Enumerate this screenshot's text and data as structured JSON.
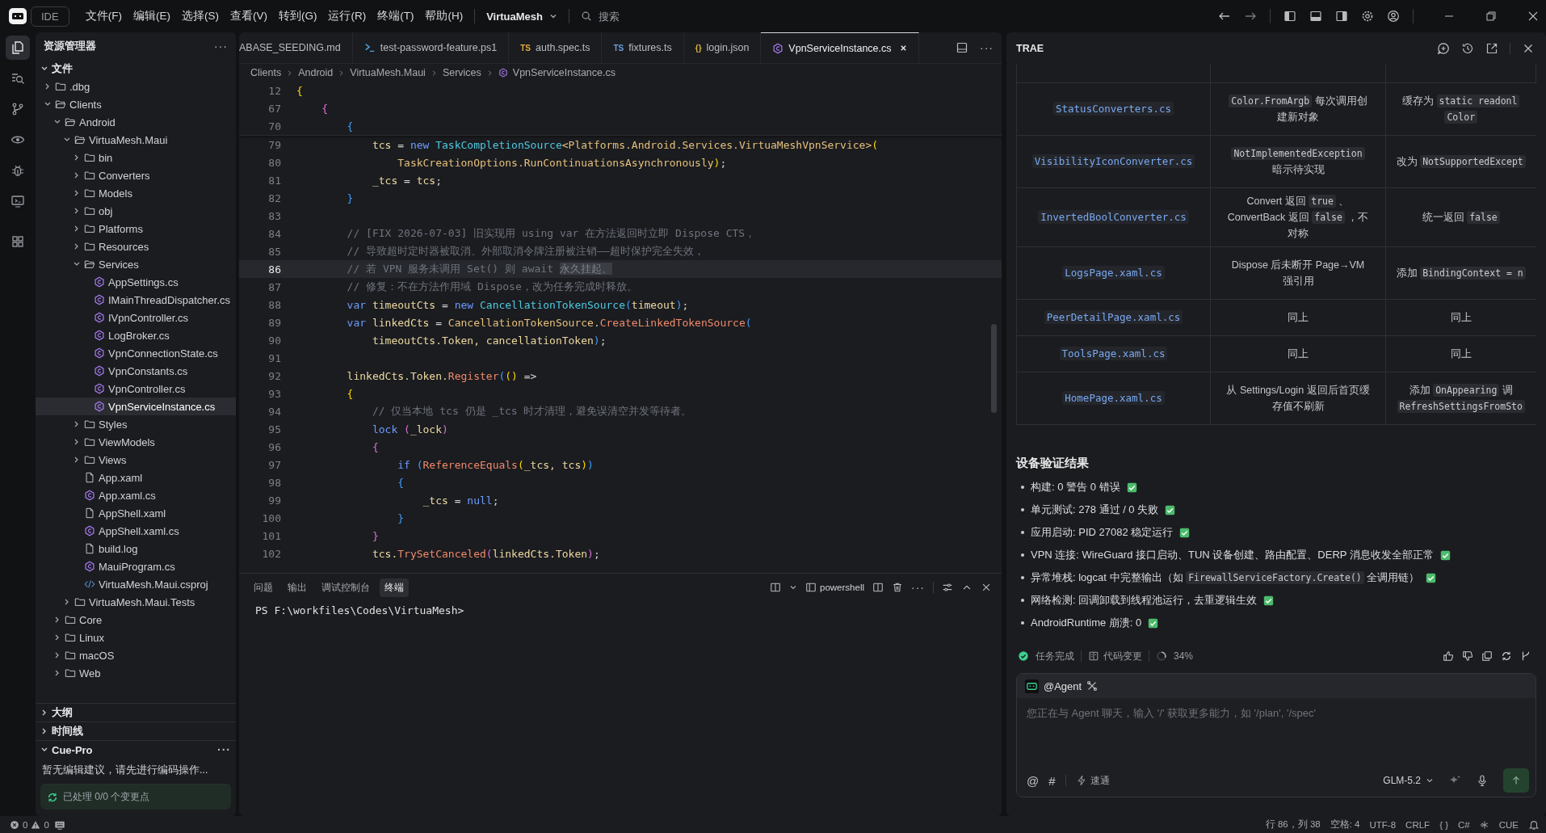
{
  "titlebar": {
    "app_button": "IDE",
    "menus": [
      "文件(F)",
      "编辑(E)",
      "选择(S)",
      "查看(V)",
      "转到(G)",
      "运行(R)",
      "终端(T)",
      "帮助(H)"
    ],
    "project": "VirtuaMesh",
    "search": {
      "placeholder": "搜索"
    }
  },
  "activity_bar": [
    {
      "kind": "files",
      "selected": true
    },
    {
      "kind": "search",
      "selected": false
    },
    {
      "kind": "source-control",
      "selected": false
    },
    {
      "kind": "preview",
      "selected": false
    },
    {
      "kind": "debug",
      "selected": false
    },
    {
      "kind": "remote",
      "selected": false
    },
    {
      "kind": "extensions",
      "selected": false
    }
  ],
  "sidebar": {
    "title": "资源管理器",
    "more": "···",
    "section": "文件",
    "tree": [
      {
        "label": ".dbg",
        "kind": "folder",
        "expanded": false,
        "selected": false
      },
      {
        "label": "Clients",
        "kind": "folder",
        "expanded": true,
        "selected": false,
        "children": [
          {
            "label": "Android",
            "kind": "folder",
            "expanded": true,
            "selected": false,
            "children": [
              {
                "label": "VirtuaMesh.Maui",
                "kind": "folder",
                "expanded": true,
                "selected": false,
                "children": [
                  {
                    "label": "bin",
                    "kind": "folder",
                    "expanded": false,
                    "selected": false
                  },
                  {
                    "label": "Converters",
                    "kind": "folder",
                    "expanded": false,
                    "selected": false
                  },
                  {
                    "label": "Models",
                    "kind": "folder",
                    "expanded": false,
                    "selected": false
                  },
                  {
                    "label": "obj",
                    "kind": "folder",
                    "expanded": false,
                    "selected": false
                  },
                  {
                    "label": "Platforms",
                    "kind": "folder",
                    "expanded": false,
                    "selected": false
                  },
                  {
                    "label": "Resources",
                    "kind": "folder",
                    "expanded": false,
                    "selected": false
                  },
                  {
                    "label": "Services",
                    "kind": "folder",
                    "expanded": true,
                    "selected": false,
                    "children": [
                      {
                        "label": "AppSettings.cs",
                        "kind": "csharp",
                        "selected": false
                      },
                      {
                        "label": "IMainThreadDispatcher.cs",
                        "kind": "csharp",
                        "selected": false
                      },
                      {
                        "label": "IVpnController.cs",
                        "kind": "csharp",
                        "selected": false
                      },
                      {
                        "label": "LogBroker.cs",
                        "kind": "csharp",
                        "selected": false
                      },
                      {
                        "label": "VpnConnectionState.cs",
                        "kind": "csharp",
                        "selected": false
                      },
                      {
                        "label": "VpnConstants.cs",
                        "kind": "csharp",
                        "selected": false
                      },
                      {
                        "label": "VpnController.cs",
                        "kind": "csharp",
                        "selected": false
                      },
                      {
                        "label": "VpnServiceInstance.cs",
                        "kind": "csharp",
                        "selected": true
                      }
                    ]
                  },
                  {
                    "label": "Styles",
                    "kind": "folder",
                    "expanded": false,
                    "selected": false
                  },
                  {
                    "label": "ViewModels",
                    "kind": "folder",
                    "expanded": false,
                    "selected": false
                  },
                  {
                    "label": "Views",
                    "kind": "folder",
                    "expanded": false,
                    "selected": false
                  },
                  {
                    "label": "App.xaml",
                    "kind": "file",
                    "selected": false
                  },
                  {
                    "label": "App.xaml.cs",
                    "kind": "csharp",
                    "selected": false
                  },
                  {
                    "label": "AppShell.xaml",
                    "kind": "file",
                    "selected": false
                  },
                  {
                    "label": "AppShell.xaml.cs",
                    "kind": "csharp",
                    "selected": false
                  },
                  {
                    "label": "build.log",
                    "kind": "file",
                    "selected": false
                  },
                  {
                    "label": "MauiProgram.cs",
                    "kind": "csharp",
                    "selected": false
                  },
                  {
                    "label": "VirtuaMesh.Maui.csproj",
                    "kind": "xml",
                    "selected": false
                  }
                ]
              },
              {
                "label": "VirtuaMesh.Maui.Tests",
                "kind": "folder",
                "expanded": false,
                "selected": false
              }
            ]
          },
          {
            "label": "Core",
            "kind": "folder",
            "expanded": false,
            "selected": false
          },
          {
            "label": "Linux",
            "kind": "folder",
            "expanded": false,
            "selected": false
          },
          {
            "label": "macOS",
            "kind": "folder",
            "expanded": false,
            "selected": false
          },
          {
            "label": "Web",
            "kind": "folder",
            "expanded": false,
            "selected": false
          }
        ]
      }
    ],
    "panels": [
      {
        "title": "大纲",
        "expanded": false
      },
      {
        "title": "时间线",
        "expanded": false
      },
      {
        "title": "Cue-Pro",
        "expanded": true,
        "more": "···",
        "message": "暂无编辑建议，请先进行编码操作...",
        "status": "已处理 0/0 个变更点"
      }
    ]
  },
  "editor": {
    "tabs": [
      {
        "label": "ABASE_SEEDING.md",
        "kind": "plain",
        "selected": false
      },
      {
        "label": "test-password-feature.ps1",
        "kind": "powershell",
        "selected": false
      },
      {
        "label": "auth.spec.ts",
        "kind": "badge",
        "badge": "TS",
        "color": "#e2a93b",
        "selected": false
      },
      {
        "label": "fixtures.ts",
        "kind": "badge",
        "badge": "TS",
        "color": "#6b9bd8",
        "selected": false
      },
      {
        "label": "login.json",
        "kind": "badge",
        "badge": "{}",
        "color": "#d7b23c",
        "selected": false
      },
      {
        "label": "VpnServiceInstance.cs",
        "kind": "csharp",
        "selected": true
      }
    ],
    "more": "···",
    "breadcrumbs": [
      "Clients",
      "Android",
      "VirtuaMesh.Maui",
      "Services",
      "VpnServiceInstance.cs"
    ],
    "sticky_lines": [
      {
        "number": "12",
        "current": false,
        "tokens": [
          {
            "kind": "b1",
            "text": "{"
          }
        ]
      },
      {
        "number": "67",
        "current": false,
        "tokens": [
          {
            "kind": "b2",
            "text": "    {"
          }
        ]
      },
      {
        "number": "70",
        "current": false,
        "tokens": [
          {
            "kind": "b3",
            "text": "        {"
          }
        ]
      }
    ],
    "lines": [
      {
        "number": "79",
        "current": false,
        "tokens": [
          {
            "kind": "id",
            "text": "            tcs"
          },
          {
            "kind": "p",
            "text": " = "
          },
          {
            "kind": "kw",
            "text": "new "
          },
          {
            "kind": "type",
            "text": "TaskCompletionSource"
          },
          {
            "kind": "cls",
            "text": "<Platforms.Android.Services.VirtuaMeshVpnService>"
          },
          {
            "kind": "b1",
            "text": "("
          }
        ]
      },
      {
        "number": "80",
        "current": false,
        "tokens": [
          {
            "kind": "cls",
            "text": "                TaskCreationOptions.RunContinuationsAsynchronously"
          },
          {
            "kind": "b1",
            "text": ")"
          },
          {
            "kind": "p",
            "text": ";"
          }
        ]
      },
      {
        "number": "81",
        "current": false,
        "tokens": [
          {
            "kind": "id",
            "text": "            _tcs"
          },
          {
            "kind": "p",
            "text": " = "
          },
          {
            "kind": "id",
            "text": "tcs"
          },
          {
            "kind": "p",
            "text": ";"
          }
        ]
      },
      {
        "number": "82",
        "current": false,
        "tokens": [
          {
            "kind": "b3",
            "text": "        }"
          }
        ]
      },
      {
        "number": "83",
        "current": false
      },
      {
        "number": "84",
        "current": false,
        "tokens": [
          {
            "kind": "c",
            "text": "        // [FIX 2026-07-03] 旧实现用 using var 在方法返回时立即 Dispose CTS，"
          }
        ]
      },
      {
        "number": "85",
        "current": false,
        "tokens": [
          {
            "kind": "c",
            "text": "        // 导致超时定时器被取消、外部取消令牌注册被注销——超时保护完全失效，"
          }
        ]
      },
      {
        "number": "86",
        "current": true,
        "tokens": [
          {
            "kind": "c",
            "text": "        // 若 VPN 服务未调用 Set() 则 await "
          },
          {
            "kind": "sel",
            "text": "永久挂起。"
          }
        ]
      },
      {
        "number": "87",
        "current": false,
        "tokens": [
          {
            "kind": "c",
            "text": "        // 修复：不在方法作用域 Dispose，改为任务完成时释放。"
          }
        ]
      },
      {
        "number": "88",
        "current": false,
        "tokens": [
          {
            "kind": "kw",
            "text": "        var"
          },
          {
            "kind": "id",
            "text": " timeoutCts"
          },
          {
            "kind": "p",
            "text": " = "
          },
          {
            "kind": "kw",
            "text": "new "
          },
          {
            "kind": "type",
            "text": "CancellationTokenSource"
          },
          {
            "kind": "b3",
            "text": "("
          },
          {
            "kind": "id",
            "text": "timeout"
          },
          {
            "kind": "b3",
            "text": ")"
          },
          {
            "kind": "p",
            "text": ";"
          }
        ]
      },
      {
        "number": "89",
        "current": false,
        "tokens": [
          {
            "kind": "kw",
            "text": "        var"
          },
          {
            "kind": "id",
            "text": " linkedCts"
          },
          {
            "kind": "p",
            "text": " = "
          },
          {
            "kind": "cls",
            "text": "CancellationTokenSource"
          },
          {
            "kind": "p",
            "text": "."
          },
          {
            "kind": "fn",
            "text": "CreateLinkedTokenSource"
          },
          {
            "kind": "b3",
            "text": "("
          }
        ]
      },
      {
        "number": "90",
        "current": false,
        "tokens": [
          {
            "kind": "id",
            "text": "            timeoutCts.Token, cancellationToken"
          },
          {
            "kind": "b3",
            "text": ")"
          },
          {
            "kind": "p",
            "text": ";"
          }
        ]
      },
      {
        "number": "91",
        "current": false
      },
      {
        "number": "92",
        "current": false,
        "tokens": [
          {
            "kind": "id",
            "text": "        linkedCts.Token."
          },
          {
            "kind": "fn",
            "text": "Register"
          },
          {
            "kind": "b3",
            "text": "("
          },
          {
            "kind": "b1",
            "text": "()"
          },
          {
            "kind": "p",
            "text": " =>"
          }
        ]
      },
      {
        "number": "93",
        "current": false,
        "tokens": [
          {
            "kind": "b1",
            "text": "        {"
          }
        ]
      },
      {
        "number": "94",
        "current": false,
        "tokens": [
          {
            "kind": "c",
            "text": "            // 仅当本地 tcs 仍是 _tcs 时才清理，避免误清空并发等待者。"
          }
        ]
      },
      {
        "number": "95",
        "current": false,
        "tokens": [
          {
            "kind": "kw",
            "text": "            lock "
          },
          {
            "kind": "b2",
            "text": "("
          },
          {
            "kind": "id",
            "text": "_lock"
          },
          {
            "kind": "b2",
            "text": ")"
          }
        ]
      },
      {
        "number": "96",
        "current": false,
        "tokens": [
          {
            "kind": "b2",
            "text": "            {"
          }
        ]
      },
      {
        "number": "97",
        "current": false,
        "tokens": [
          {
            "kind": "kw",
            "text": "                if "
          },
          {
            "kind": "b3",
            "text": "("
          },
          {
            "kind": "fn",
            "text": "ReferenceEquals"
          },
          {
            "kind": "b1",
            "text": "("
          },
          {
            "kind": "id",
            "text": "_tcs, tcs"
          },
          {
            "kind": "b1",
            "text": ")"
          },
          {
            "kind": "b3",
            "text": ")"
          }
        ]
      },
      {
        "number": "98",
        "current": false,
        "tokens": [
          {
            "kind": "b3",
            "text": "                {"
          }
        ]
      },
      {
        "number": "99",
        "current": false,
        "tokens": [
          {
            "kind": "id",
            "text": "                    _tcs"
          },
          {
            "kind": "p",
            "text": " = "
          },
          {
            "kind": "kw",
            "text": "null"
          },
          {
            "kind": "p",
            "text": ";"
          }
        ]
      },
      {
        "number": "100",
        "current": false,
        "tokens": [
          {
            "kind": "b3",
            "text": "                }"
          }
        ]
      },
      {
        "number": "101",
        "current": false,
        "tokens": [
          {
            "kind": "b2",
            "text": "            }"
          }
        ]
      },
      {
        "number": "102",
        "current": false,
        "tokens": [
          {
            "kind": "id",
            "text": "            tcs."
          },
          {
            "kind": "fn",
            "text": "TrySetCanceled"
          },
          {
            "kind": "b2",
            "text": "("
          },
          {
            "kind": "id",
            "text": "linkedCts.Token"
          },
          {
            "kind": "b2",
            "text": ")"
          },
          {
            "kind": "p",
            "text": ";"
          }
        ]
      }
    ]
  },
  "terminal": {
    "tabs": [
      {
        "label": "问题",
        "selected": false
      },
      {
        "label": "输出",
        "selected": false
      },
      {
        "label": "调试控制台",
        "selected": false
      },
      {
        "label": "终端",
        "selected": true
      }
    ],
    "shell": "powershell",
    "more": "···",
    "prompt": "PS F:\\workfiles\\Codes\\VirtuaMesh>"
  },
  "assistant": {
    "title": "TRAE",
    "table": {
      "rows": [
        {
          "file": "StatusConverters.cs",
          "problem": [
            [
              {
                "kind": "code",
                "text": "Color.FromArgb"
              },
              {
                "kind": "text",
                "text": " 每次调用创"
              }
            ],
            [
              {
                "kind": "text",
                "text": "建新对象"
              }
            ]
          ],
          "fix": [
            [
              {
                "kind": "text",
                "text": "缓存为 "
              },
              {
                "kind": "code",
                "text": "static readonl"
              }
            ],
            [
              {
                "kind": "code",
                "text": "Color"
              }
            ]
          ]
        },
        {
          "file": "VisibilityIconConverter.cs",
          "problem": [
            [
              {
                "kind": "code",
                "text": "NotImplementedException"
              }
            ],
            [
              {
                "kind": "text",
                "text": "暗示待实现"
              }
            ]
          ],
          "fix": [
            [
              {
                "kind": "text",
                "text": "改为 "
              },
              {
                "kind": "code",
                "text": "NotSupportedExcept"
              }
            ]
          ]
        },
        {
          "file": "InvertedBoolConverter.cs",
          "problem": [
            [
              {
                "kind": "text",
                "text": "Convert 返回 "
              },
              {
                "kind": "code",
                "text": "true"
              },
              {
                "kind": "text",
                "text": " 、"
              }
            ],
            [
              {
                "kind": "text",
                "text": "ConvertBack 返回 "
              },
              {
                "kind": "code",
                "text": "false"
              },
              {
                "kind": "text",
                "text": " ，不"
              }
            ],
            [
              {
                "kind": "text",
                "text": "对称"
              }
            ]
          ],
          "fix": [
            [
              {
                "kind": "text",
                "text": "统一返回 "
              },
              {
                "kind": "code",
                "text": "false"
              }
            ]
          ]
        },
        {
          "file": "LogsPage.xaml.cs",
          "problem": [
            [
              {
                "kind": "text",
                "text": "Dispose 后未断开 Page→VM"
              }
            ],
            [
              {
                "kind": "text",
                "text": "强引用"
              }
            ]
          ],
          "fix": [
            [
              {
                "kind": "text",
                "text": "添加 "
              },
              {
                "kind": "code",
                "text": "BindingContext = n"
              }
            ]
          ]
        },
        {
          "file": "PeerDetailPage.xaml.cs",
          "problem": [
            [
              {
                "kind": "text",
                "text": "同上"
              }
            ]
          ],
          "fix": [
            [
              {
                "kind": "text",
                "text": "同上"
              }
            ]
          ]
        },
        {
          "file": "ToolsPage.xaml.cs",
          "problem": [
            [
              {
                "kind": "text",
                "text": "同上"
              }
            ]
          ],
          "fix": [
            [
              {
                "kind": "text",
                "text": "同上"
              }
            ]
          ]
        },
        {
          "file": "HomePage.xaml.cs",
          "problem": [
            [
              {
                "kind": "text",
                "text": "从 Settings/Login 返回后首页缓"
              }
            ],
            [
              {
                "kind": "text",
                "text": "存值不刷新"
              }
            ]
          ],
          "fix": [
            [
              {
                "kind": "text",
                "text": "添加 "
              },
              {
                "kind": "code",
                "text": "OnAppearing"
              },
              {
                "kind": "text",
                "text": " 调"
              }
            ],
            [
              {
                "kind": "code",
                "text": "RefreshSettingsFromSto"
              }
            ]
          ]
        }
      ]
    },
    "heading": "设备验证结果",
    "results": [
      {
        "done": true,
        "segments": [
          {
            "kind": "text",
            "text": "构建: 0 警告 0 错误"
          }
        ]
      },
      {
        "done": true,
        "segments": [
          {
            "kind": "text",
            "text": "单元测试: 278 通过 / 0 失败"
          }
        ]
      },
      {
        "done": true,
        "segments": [
          {
            "kind": "text",
            "text": "应用启动: PID 27082 稳定运行"
          }
        ]
      },
      {
        "done": true,
        "segments": [
          {
            "kind": "text",
            "text": "VPN 连接: WireGuard 接口启动、TUN 设备创建、路由配置、DERP 消息收发全部正常"
          }
        ]
      },
      {
        "done": true,
        "segments": [
          {
            "kind": "text",
            "text": "异常堆栈: logcat 中完整输出（如 "
          },
          {
            "kind": "code",
            "text": "FirewallServiceFactory.Create()"
          },
          {
            "kind": "text",
            "text": " 全调用链）"
          }
        ]
      },
      {
        "done": true,
        "segments": [
          {
            "kind": "text",
            "text": "网络检测: 回调卸载到线程池运行，去重逻辑生效"
          }
        ]
      },
      {
        "done": true,
        "segments": [
          {
            "kind": "text",
            "text": "AndroidRuntime 崩溃: 0"
          }
        ]
      }
    ],
    "status": {
      "task": "任务完成",
      "changes": "代码变更",
      "progress": "34%"
    },
    "chat": {
      "agent": "@Agent",
      "placeholder": "您正在与 Agent 聊天，输入 '/' 获取更多能力，如 '/plan', '/spec'",
      "at": "@",
      "hash": "#",
      "mode": "速通",
      "model": "GLM-5.2"
    }
  },
  "status_bar": {
    "errors": "0",
    "warnings": "0",
    "items": [
      "行 86，列 38",
      "空格: 4",
      "UTF-8",
      "CRLF",
      "{ }",
      "C#",
      "CUE"
    ]
  }
}
